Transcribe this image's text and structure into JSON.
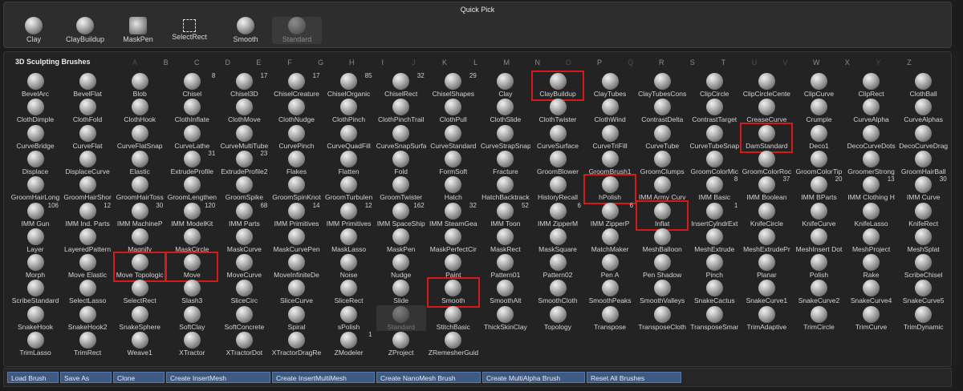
{
  "quick_pick": {
    "title": "Quick Pick",
    "items": [
      {
        "label": "Clay",
        "icon": "sphere-icon"
      },
      {
        "label": "ClayBuildup",
        "icon": "sphere-icon"
      },
      {
        "label": "MaskPen",
        "icon": "mask-pen-icon"
      },
      {
        "label": "SelectRect",
        "icon": "dashed-rect-icon"
      },
      {
        "label": "Smooth",
        "icon": "sphere-icon"
      },
      {
        "label": "Standard",
        "icon": "sphere-icon",
        "dim": true
      }
    ]
  },
  "panel": {
    "title": "3D Sculpting Brushes",
    "letters": [
      {
        "t": "A",
        "dim": true
      },
      {
        "t": "B"
      },
      {
        "t": "C"
      },
      {
        "t": "D"
      },
      {
        "t": "E"
      },
      {
        "t": "F"
      },
      {
        "t": "G"
      },
      {
        "t": "H"
      },
      {
        "t": "I"
      },
      {
        "t": "J",
        "dim": true
      },
      {
        "t": "K"
      },
      {
        "t": "L"
      },
      {
        "t": "M"
      },
      {
        "t": "N"
      },
      {
        "t": "O",
        "dim": true
      },
      {
        "t": "P"
      },
      {
        "t": "Q",
        "dim": true
      },
      {
        "t": "R"
      },
      {
        "t": "S"
      },
      {
        "t": "T"
      },
      {
        "t": "U",
        "dim": true
      },
      {
        "t": "V",
        "dim": true
      },
      {
        "t": "W"
      },
      {
        "t": "X"
      },
      {
        "t": "Y",
        "dim": true
      },
      {
        "t": "Z"
      }
    ],
    "rows": [
      [
        {
          "l": "BevelArc"
        },
        {
          "l": "BevelFlat"
        },
        {
          "l": "Blob"
        },
        {
          "l": "Chisel",
          "n": "8"
        },
        {
          "l": "Chisel3D",
          "n": "17"
        },
        {
          "l": "ChiselCreature",
          "n": "17"
        },
        {
          "l": "ChiselOrganic",
          "n": "85"
        },
        {
          "l": "ChiselRect",
          "n": "32"
        },
        {
          "l": "ChiselShapes",
          "n": "29"
        },
        {
          "l": "Clay"
        },
        {
          "l": "ClayBuildup",
          "hl": true
        },
        {
          "l": "ClayTubes"
        },
        {
          "l": "ClayTubesCons"
        },
        {
          "l": "ClipCircle"
        },
        {
          "l": "ClipCircleCente"
        },
        {
          "l": "ClipCurve"
        },
        {
          "l": "ClipRect"
        },
        {
          "l": "ClothBall"
        }
      ],
      [
        {
          "l": "ClothDimple"
        },
        {
          "l": "ClothFold"
        },
        {
          "l": "ClothHook"
        },
        {
          "l": "ClothInflate"
        },
        {
          "l": "ClothMove"
        },
        {
          "l": "ClothNudge"
        },
        {
          "l": "ClothPinch"
        },
        {
          "l": "ClothPinchTrail"
        },
        {
          "l": "ClothPull"
        },
        {
          "l": "ClothSlide"
        },
        {
          "l": "ClothTwister"
        },
        {
          "l": "ClothWind"
        },
        {
          "l": "ContrastDelta"
        },
        {
          "l": "ContrastTarget"
        },
        {
          "l": "CreaseCurve"
        },
        {
          "l": "Crumple"
        },
        {
          "l": "CurveAlpha"
        },
        {
          "l": "CurveAlphas"
        }
      ],
      [
        {
          "l": "CurveBridge"
        },
        {
          "l": "CurveFlat"
        },
        {
          "l": "CurveFlatSnap"
        },
        {
          "l": "CurveLathe"
        },
        {
          "l": "CurveMultiTube"
        },
        {
          "l": "CurvePinch"
        },
        {
          "l": "CurveQuadFill"
        },
        {
          "l": "CurveSnapSurfa"
        },
        {
          "l": "CurveStandard"
        },
        {
          "l": "CurveStrapSnap"
        },
        {
          "l": "CurveSurface"
        },
        {
          "l": "CurveTriFill"
        },
        {
          "l": "CurveTube"
        },
        {
          "l": "CurveTubeSnap"
        },
        {
          "l": "DamStandard",
          "hl": true
        },
        {
          "l": "Deco1"
        },
        {
          "l": "DecoCurveDots"
        },
        {
          "l": "DecoCurveDrag"
        }
      ],
      [
        {
          "l": "Displace"
        },
        {
          "l": "DisplaceCurve"
        },
        {
          "l": "Elastic"
        },
        {
          "l": "ExtrudeProfile",
          "n": "31"
        },
        {
          "l": "ExtrudeProfile2",
          "n": "23"
        },
        {
          "l": "Flakes"
        },
        {
          "l": "Flatten"
        },
        {
          "l": "Fold"
        },
        {
          "l": "FormSoft"
        },
        {
          "l": "Fracture"
        },
        {
          "l": "GroomBlower"
        },
        {
          "l": "GroomBrush1"
        },
        {
          "l": "GroomClumps"
        },
        {
          "l": "GroomColorMic"
        },
        {
          "l": "GroomColorRoc"
        },
        {
          "l": "GroomColorTip"
        },
        {
          "l": "GroomerStrong"
        },
        {
          "l": "GroomHairBall"
        }
      ],
      [
        {
          "l": "GroomHairLong"
        },
        {
          "l": "GroomHairShor"
        },
        {
          "l": "GroomHairToss"
        },
        {
          "l": "GroomLengthen"
        },
        {
          "l": "GroomSpike"
        },
        {
          "l": "GroomSpinKnot"
        },
        {
          "l": "GroomTurbulen"
        },
        {
          "l": "GroomTwister"
        },
        {
          "l": "Hatch"
        },
        {
          "l": "HatchBacktrack"
        },
        {
          "l": "HistoryRecall"
        },
        {
          "l": "hPolish",
          "hl": true
        },
        {
          "l": "IMM Army Curv"
        },
        {
          "l": "IMM Basic",
          "n": "8"
        },
        {
          "l": "IMM Boolean",
          "n": "37"
        },
        {
          "l": "IMM BParts",
          "n": "20"
        },
        {
          "l": "IMM Clothing H",
          "n": "13"
        },
        {
          "l": "IMM Curve",
          "n": "30"
        }
      ],
      [
        {
          "l": "IMM Gun",
          "n": "106"
        },
        {
          "l": "IMM Ind. Parts",
          "n": "12"
        },
        {
          "l": "IMM MachineP",
          "n": "30"
        },
        {
          "l": "IMM ModelKit",
          "n": "120"
        },
        {
          "l": "IMM Parts",
          "n": "68"
        },
        {
          "l": "IMM Primitives",
          "n": "14"
        },
        {
          "l": "IMM Primitives",
          "n": "12"
        },
        {
          "l": "IMM SpaceShip",
          "n": "162"
        },
        {
          "l": "IMM SteamGea",
          "n": "32"
        },
        {
          "l": "IMM Toon",
          "n": "52"
        },
        {
          "l": "IMM ZipperM",
          "n": "6"
        },
        {
          "l": "IMM ZipperP",
          "n": "6"
        },
        {
          "l": "Inflat",
          "hl": true
        },
        {
          "l": "InsertCylndrExt",
          "n": "1"
        },
        {
          "l": "KnifeCircle"
        },
        {
          "l": "KnifeCurve"
        },
        {
          "l": "KnifeLasso"
        },
        {
          "l": "KnifeRect"
        }
      ],
      [
        {
          "l": "Layer"
        },
        {
          "l": "LayeredPattern"
        },
        {
          "l": "Magnify"
        },
        {
          "l": "MaskCircle"
        },
        {
          "l": "MaskCurve"
        },
        {
          "l": "MaskCurvePen"
        },
        {
          "l": "MaskLasso"
        },
        {
          "l": "MaskPen"
        },
        {
          "l": "MaskPerfectCir"
        },
        {
          "l": "MaskRect"
        },
        {
          "l": "MaskSquare"
        },
        {
          "l": "MatchMaker"
        },
        {
          "l": "MeshBalloon"
        },
        {
          "l": "MeshExtrude"
        },
        {
          "l": "MeshExtrudePr"
        },
        {
          "l": "MeshInsert Dot"
        },
        {
          "l": "MeshProject"
        },
        {
          "l": "MeshSplat"
        }
      ],
      [
        {
          "l": "Morph"
        },
        {
          "l": "Move Elastic"
        },
        {
          "l": "Move Topologic",
          "hl": true
        },
        {
          "l": "Move",
          "hl": true
        },
        {
          "l": "MoveCurve"
        },
        {
          "l": "MoveInfiniteDe"
        },
        {
          "l": "Noise"
        },
        {
          "l": "Nudge"
        },
        {
          "l": "Paint"
        },
        {
          "l": "Pattern01"
        },
        {
          "l": "Pattern02"
        },
        {
          "l": "Pen A"
        },
        {
          "l": "Pen Shadow"
        },
        {
          "l": "Pinch"
        },
        {
          "l": "Planar"
        },
        {
          "l": "Polish"
        },
        {
          "l": "Rake"
        },
        {
          "l": "ScribeChisel"
        }
      ],
      [
        {
          "l": "ScribeStandard"
        },
        {
          "l": "SelectLasso"
        },
        {
          "l": "SelectRect"
        },
        {
          "l": "Slash3"
        },
        {
          "l": "SliceCirc"
        },
        {
          "l": "SliceCurve"
        },
        {
          "l": "SliceRect"
        },
        {
          "l": "Slide"
        },
        {
          "l": "Smooth",
          "hl": true
        },
        {
          "l": "SmoothAlt"
        },
        {
          "l": "SmoothCloth"
        },
        {
          "l": "SmoothPeaks"
        },
        {
          "l": "SmoothValleys"
        },
        {
          "l": "SnakeCactus"
        },
        {
          "l": "SnakeCurve1"
        },
        {
          "l": "SnakeCurve2"
        },
        {
          "l": "SnakeCurve4"
        },
        {
          "l": "SnakeCurve5"
        }
      ],
      [
        {
          "l": "SnakeHook"
        },
        {
          "l": "SnakeHook2"
        },
        {
          "l": "SnakeSphere"
        },
        {
          "l": "SoftClay"
        },
        {
          "l": "SoftConcrete"
        },
        {
          "l": "Spiral"
        },
        {
          "l": "sPolish"
        },
        {
          "l": "Standard",
          "dim": true
        },
        {
          "l": "StitchBasic"
        },
        {
          "l": "ThickSkinClay"
        },
        {
          "l": "Topology"
        },
        {
          "l": "Transpose"
        },
        {
          "l": "TransposeCloth"
        },
        {
          "l": "TransposeSmar"
        },
        {
          "l": "TrimAdaptive"
        },
        {
          "l": "TrimCircle"
        },
        {
          "l": "TrimCurve"
        },
        {
          "l": "TrimDynamic"
        }
      ],
      [
        {
          "l": "TrimLasso"
        },
        {
          "l": "TrimRect"
        },
        {
          "l": "Weave1"
        },
        {
          "l": "XTractor"
        },
        {
          "l": "XTractorDot"
        },
        {
          "l": "XTractorDragRe"
        },
        {
          "l": "ZModeler",
          "n": "1"
        },
        {
          "l": "ZProject"
        },
        {
          "l": "ZRemesherGuid"
        }
      ]
    ]
  },
  "bottom_buttons": [
    {
      "label": "Load Brush"
    },
    {
      "label": "Save As"
    },
    {
      "label": "Clone"
    },
    {
      "label": "Create InsertMesh"
    },
    {
      "label": "Create InsertMultiMesh"
    },
    {
      "label": "Create NanoMesh Brush"
    },
    {
      "label": "Create MultiAlpha Brush"
    },
    {
      "label": "Reset All Brushes"
    }
  ],
  "colors": {
    "highlight": "#d61a1a",
    "panel_bg": "#232323",
    "button_blue": "#3e5a82"
  }
}
